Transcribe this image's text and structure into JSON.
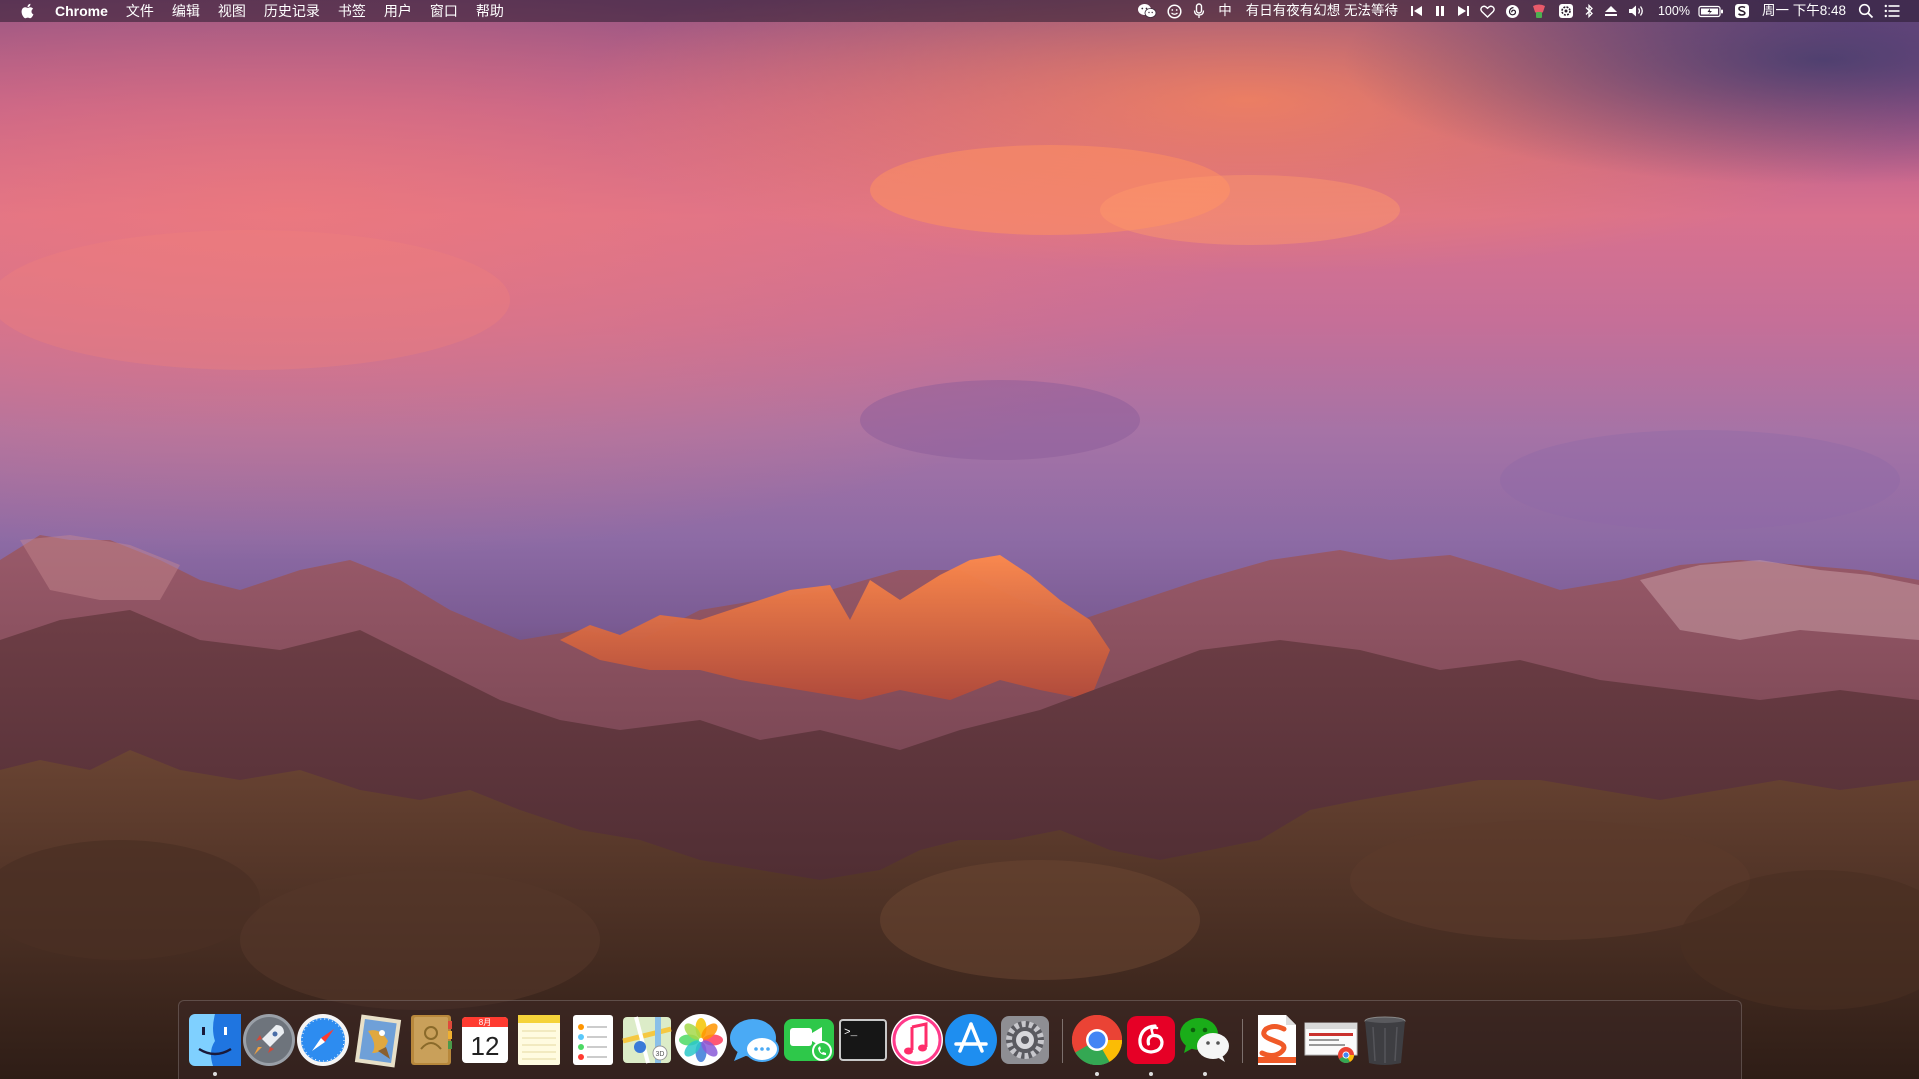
{
  "menubar": {
    "app_name": "Chrome",
    "menus": [
      "文件",
      "编辑",
      "视图",
      "历史记录",
      "书签",
      "用户",
      "窗口",
      "帮助"
    ],
    "input_method": "中",
    "now_playing": "有日有夜有幻想 无法等待",
    "battery": "100%",
    "clock": "周一 下午8:48"
  },
  "calendar_icon": {
    "month": "8月",
    "day": "12"
  },
  "dock_apps": [
    "Finder",
    "Launchpad",
    "Safari",
    "Mail",
    "Contacts",
    "Calendar",
    "Notes",
    "Reminders",
    "Maps",
    "Photos",
    "Messages",
    "FaceTime",
    "Terminal",
    "iTunes",
    "App Store",
    "System Preferences",
    "Google Chrome",
    "NetEase Cloud Music",
    "WeChat",
    "Sogou Input",
    "Chrome Web App",
    "Trash"
  ],
  "colors": {
    "menubar_bg": "#2b1d2e",
    "chrome_red": "#ea4335",
    "chrome_green": "#34a853",
    "chrome_yellow": "#fbbc05",
    "chrome_blue": "#4285f4",
    "netease_red": "#e60026",
    "wechat_green": "#1aad19"
  }
}
